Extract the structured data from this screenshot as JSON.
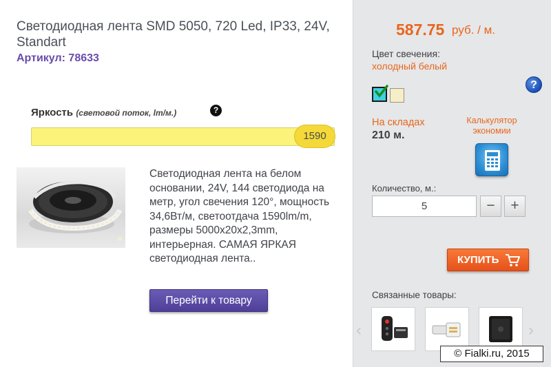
{
  "product": {
    "title": "Светодиодная лента SMD 5050, 720 Led, IP33, 24V, Standart",
    "sku": "Артикул: 78633",
    "brightness_label": "Яркость",
    "brightness_sub": "(световой поток, lm/м.)",
    "brightness_value": "1590",
    "help_small": "?",
    "description": "Светодиодная лента на белом основании, 24V, 144 светодиода на метр, угол свечения 120°, мощность 34,6Вт/м, светоотдача 1590lm/m, размеры 5000x20x2,3mm, интерьерная. САМАЯ ЯРКАЯ светодиодная лента..",
    "goto_label": "Перейти к товару"
  },
  "purchase": {
    "price": "587.75",
    "price_unit": "руб. / м.",
    "color_label": "Цвет свечения:",
    "color_value": "холодный белый",
    "help_big": "?",
    "swatches": [
      {
        "name": "swatch-cold-white",
        "color": "#3fd0e4",
        "selected": true
      },
      {
        "name": "swatch-warm-white",
        "color": "#f6edc9",
        "selected": false
      }
    ],
    "stock_label": "На складах",
    "stock_value": "210 м.",
    "calc_label": "Калькулятор экономии",
    "qty_label": "Количество, м.:",
    "qty_value": "5",
    "minus": "−",
    "plus": "+",
    "buy_label": "КУПИТЬ"
  },
  "related": {
    "label": "Связанные товары:",
    "prev": "‹",
    "next": "›",
    "items": [
      "remote-controller-icon",
      "led-connector-icon",
      "touch-panel-icon"
    ]
  },
  "watermark": "© Fialki.ru, 2015",
  "colors": {
    "accent_orange": "#e8661c",
    "purple_button": "#5a4aa6",
    "brightness_bar": "#fbf37a",
    "panel_bg": "#e6e7e9"
  }
}
